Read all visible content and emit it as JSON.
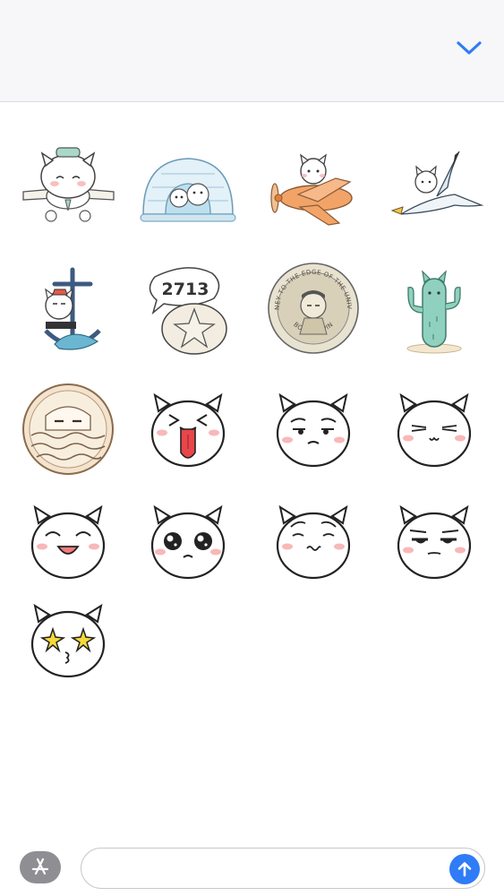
{
  "header": {
    "collapse_icon": "chevron-down-icon",
    "accent_color": "#2f7cf6"
  },
  "stickers": [
    {
      "name": "sticker-pilot-devil-airplane",
      "subject": "devil character with pilot hat on airplane"
    },
    {
      "name": "sticker-igloo-bears",
      "subject": "polar bears in igloo"
    },
    {
      "name": "sticker-devil-propeller-plane",
      "subject": "devil character flying orange propeller plane"
    },
    {
      "name": "sticker-devil-seagull",
      "subject": "devil character riding seagull"
    },
    {
      "name": "sticker-sailor-devil-anchor",
      "subject": "sailor devil with anchor"
    },
    {
      "name": "sticker-2713-star-bubble",
      "subject": "speech bubble with 2713 and star"
    },
    {
      "name": "sticker-coin-edge-universe",
      "subject": "coin with text",
      "coin_text_top": "JOURNEY TO THE EDGE OF THE UNIVERSE",
      "coin_text_bottom": "BOSS ZHIPIN"
    },
    {
      "name": "sticker-devil-cactus",
      "subject": "devil cactus"
    },
    {
      "name": "sticker-devil-coin-waves",
      "subject": "devil in round coin with waves"
    },
    {
      "name": "sticker-devil-tongue-out",
      "subject": "devil face tongue out"
    },
    {
      "name": "sticker-devil-smug",
      "subject": "devil face smug"
    },
    {
      "name": "sticker-devil-lines-eyes",
      "subject": "devil face squint lines"
    },
    {
      "name": "sticker-devil-happy-smile",
      "subject": "devil face happy"
    },
    {
      "name": "sticker-devil-teary-eyes",
      "subject": "devil face teary eyes"
    },
    {
      "name": "sticker-devil-worried",
      "subject": "devil face worried"
    },
    {
      "name": "sticker-devil-bored",
      "subject": "devil face bored"
    },
    {
      "name": "sticker-devil-star-eyes",
      "subject": "devil face star eyes"
    }
  ],
  "sticker_bubble_text": "2713",
  "bottom_bar": {
    "appstore_icon": "app-store-icon",
    "message_value": "",
    "send_icon": "send-arrow-icon",
    "send_color": "#2f7cf6"
  }
}
